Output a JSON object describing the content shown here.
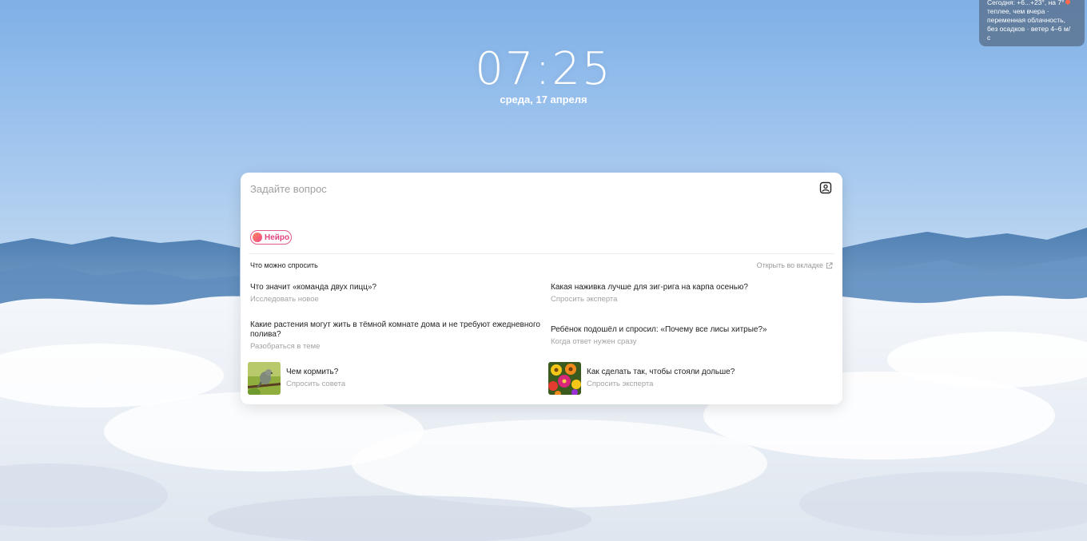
{
  "weather": {
    "text": "Сегодня: +6...+23°, на 7° теплее, чем вчера · переменная облачность, без осадков · ветер 4–6 м/с",
    "icon": "thermometer-icon"
  },
  "clock": {
    "time": "07:25",
    "date": "среда, 17 апреля"
  },
  "search": {
    "placeholder": "Задайте вопрос",
    "image_search_icon": "image-search-icon",
    "neuro_label": "Нейро"
  },
  "suggestions": {
    "title": "Что можно спросить",
    "open_tab_label": "Открыть во вкладке",
    "items": [
      {
        "question": "Что значит «команда двух пицц»?",
        "hint": "Исследовать новое"
      },
      {
        "question": "Какая наживка лучше для зиг-рига на карпа осенью?",
        "hint": "Спросить эксперта"
      },
      {
        "question": "Какие растения могут жить в тёмной комнате дома и не требуют ежедневного полива?",
        "hint": "Разобраться в теме"
      },
      {
        "question": "Ребёнок подошёл и спросил: «Почему все лисы хитрые?»",
        "hint": "Когда ответ нужен сразу"
      },
      {
        "question": "Чем кормить?",
        "hint": "Спросить совета"
      },
      {
        "question": "Как сделать так, чтобы стояли дольше?",
        "hint": "Спросить эксперта"
      }
    ]
  },
  "colors": {
    "accent": "#e0447f",
    "card_bg": "#ffffff",
    "weather_bg": "#58708c"
  }
}
